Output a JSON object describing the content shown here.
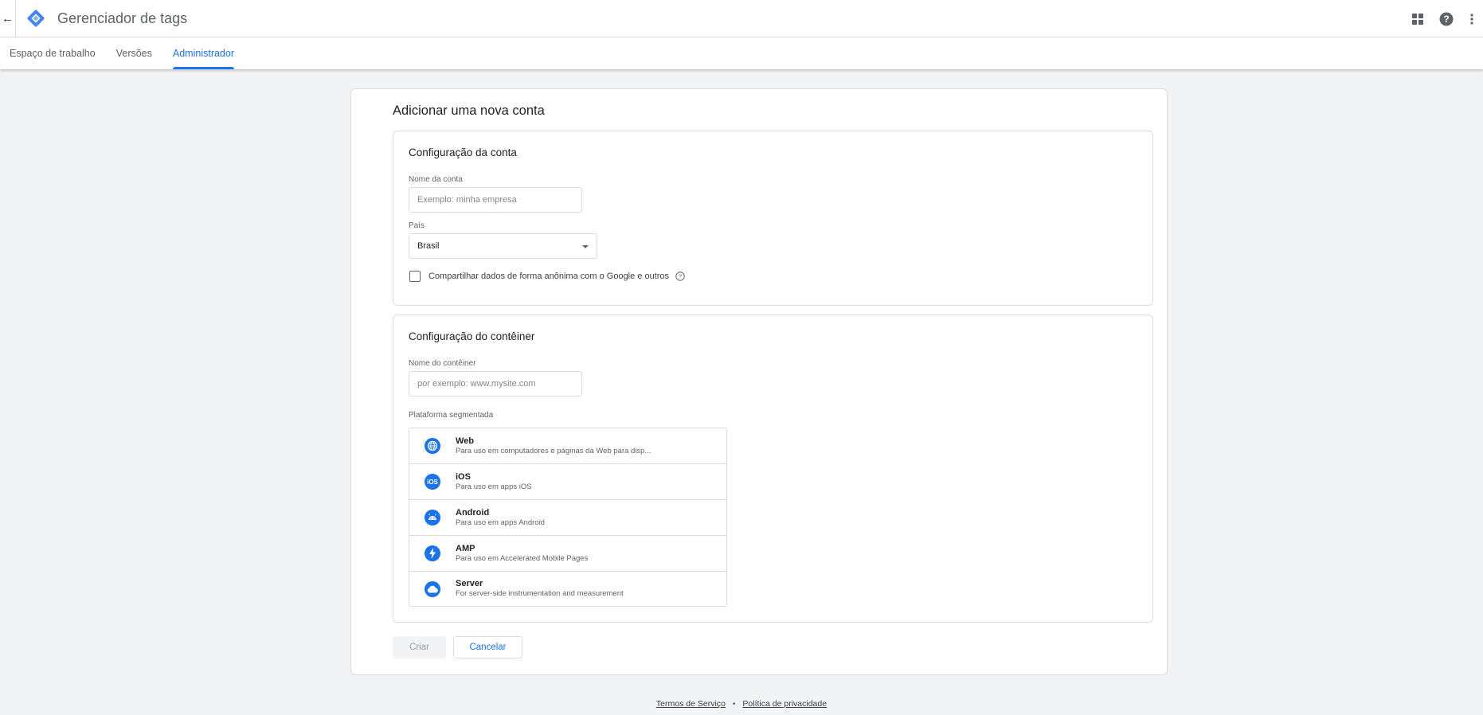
{
  "appbar": {
    "title": "Gerenciador de tags",
    "back_icon": "arrow-back-icon",
    "logo_icon": "tag-manager-logo-icon",
    "right_icons": [
      "apps-grid-icon",
      "help-icon",
      "more-vert-icon"
    ]
  },
  "tabs": [
    {
      "label": "Espaço de trabalho",
      "active": false
    },
    {
      "label": "Versões",
      "active": false
    },
    {
      "label": "Administrador",
      "active": true
    }
  ],
  "page": {
    "title": "Adicionar uma nova conta"
  },
  "account_section": {
    "title": "Configuração da conta",
    "name_label": "Nome da conta",
    "name_placeholder": "Exemplo: minha empresa",
    "name_value": "",
    "country_label": "País",
    "country_value": "Brasil",
    "share_label": "Compartilhar dados de forma anônima com o Google e outros",
    "share_checked": false
  },
  "container_section": {
    "title": "Configuração do contêiner",
    "name_label": "Nome do contêiner",
    "name_placeholder": "por exemplo: www.mysite.com",
    "name_value": "",
    "platform_label": "Plataforma segmentada",
    "platforms": [
      {
        "name": "Web",
        "desc": "Para uso em computadores e páginas da Web para disp...",
        "icon": "globe-icon"
      },
      {
        "name": "iOS",
        "desc": "Para uso em apps iOS",
        "icon": "ios-icon"
      },
      {
        "name": "Android",
        "desc": "Para uso em apps Android",
        "icon": "android-icon"
      },
      {
        "name": "AMP",
        "desc": "Para uso em Accelerated Mobile Pages",
        "icon": "amp-bolt-icon"
      },
      {
        "name": "Server",
        "desc": "For server-side instrumentation and measurement",
        "icon": "cloud-icon"
      }
    ]
  },
  "actions": {
    "create_label": "Criar",
    "cancel_label": "Cancelar"
  },
  "footer": {
    "terms": "Termos de Serviço",
    "separator": "•",
    "privacy": "Política de privacidade"
  },
  "colors": {
    "accent": "#1a73e8",
    "background": "#f1f3f4",
    "border": "#dadce0"
  }
}
